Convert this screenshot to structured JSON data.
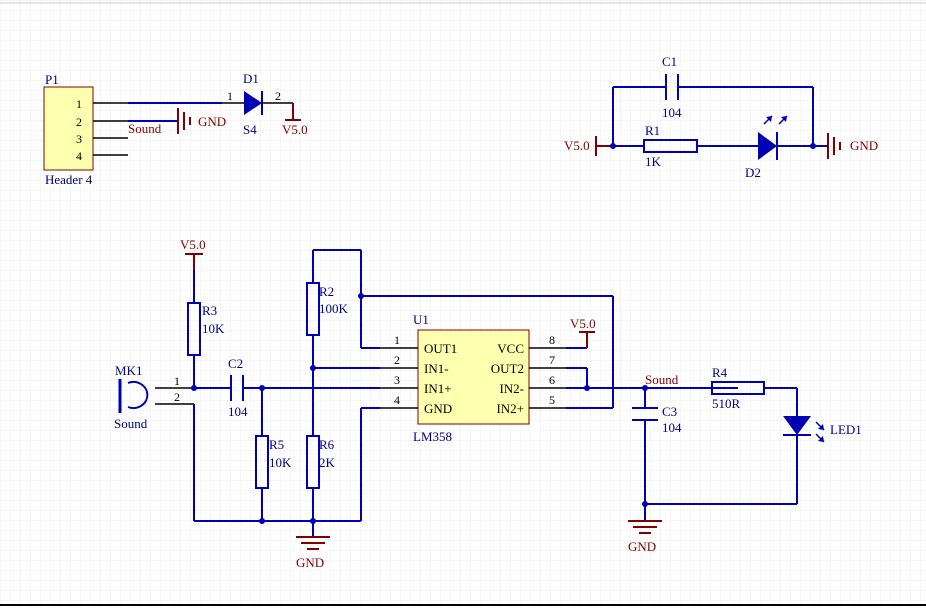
{
  "colors": {
    "wire": "#0000b4",
    "component": "#0000b4",
    "label": "#000080",
    "power": "#800000",
    "ic_fill": "#ffffb0",
    "ic_stroke": "#800000",
    "header_fill": "#ffffb0",
    "grid": "#ebebeb",
    "pin_line": "#000000"
  },
  "header": {
    "ref": "P1",
    "name": "Header 4",
    "pins": [
      "1",
      "2",
      "3",
      "4"
    ]
  },
  "d1": {
    "ref": "D1",
    "value": "S4",
    "pin1": "1",
    "pin2": "2"
  },
  "c1": {
    "ref": "C1",
    "value": "104"
  },
  "r1": {
    "ref": "R1",
    "value": "1K"
  },
  "d2": {
    "ref": "D2"
  },
  "r2": {
    "ref": "R2",
    "value": "100K"
  },
  "r3": {
    "ref": "R3",
    "value": "10K"
  },
  "r5": {
    "ref": "R5",
    "value": "10K"
  },
  "r6": {
    "ref": "R6",
    "value": "2K"
  },
  "r4": {
    "ref": "R4",
    "value": "510R"
  },
  "c2": {
    "ref": "C2",
    "value": "104"
  },
  "c3": {
    "ref": "C3",
    "value": "104"
  },
  "led1": {
    "ref": "LED1"
  },
  "mk1": {
    "ref": "MK1",
    "value": "Sound",
    "pin1": "1",
    "pin2": "2"
  },
  "u1": {
    "ref": "U1",
    "value": "LM358",
    "left_pins": [
      {
        "num": "1",
        "name": "OUT1"
      },
      {
        "num": "2",
        "name": "IN1-"
      },
      {
        "num": "3",
        "name": "IN1+"
      },
      {
        "num": "4",
        "name": "GND"
      }
    ],
    "right_pins": [
      {
        "num": "8",
        "name": "VCC"
      },
      {
        "num": "7",
        "name": "OUT2"
      },
      {
        "num": "6",
        "name": "IN2-"
      },
      {
        "num": "5",
        "name": "IN2+"
      }
    ]
  },
  "nets": {
    "gnd": "GND",
    "vcc": "V5.0",
    "sound": "Sound"
  }
}
